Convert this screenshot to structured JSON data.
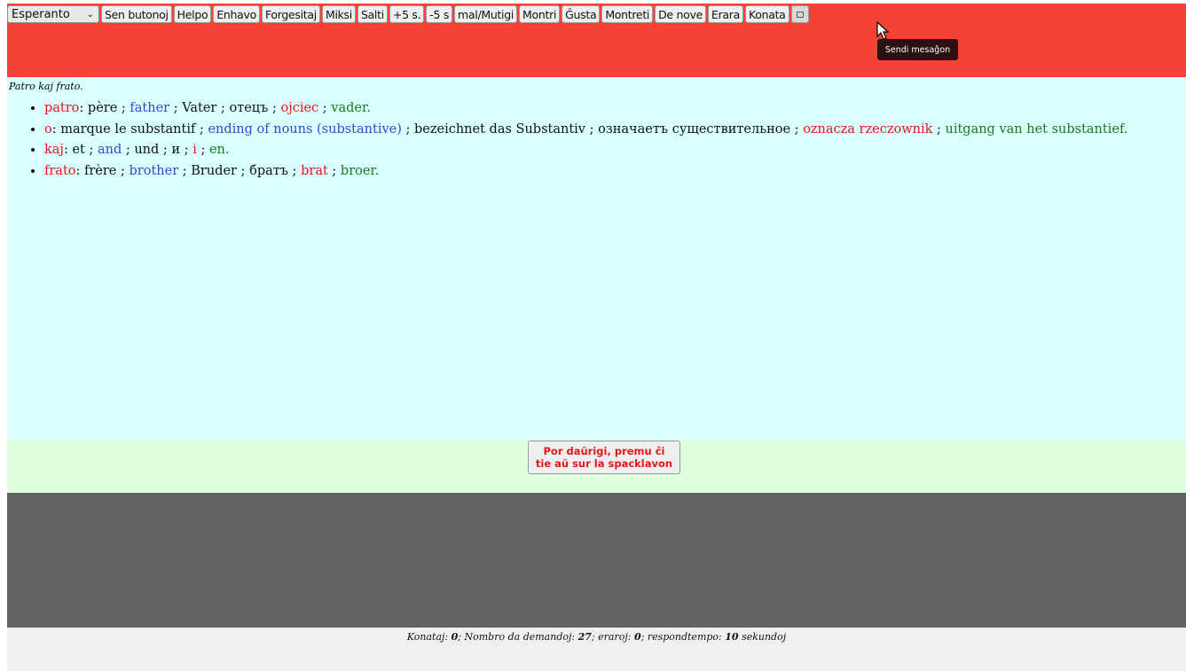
{
  "toolbar": {
    "language_select": "Esperanto",
    "buttons": [
      "Sen butonoj",
      "Helpo",
      "Enhavo",
      "Forgesitaj",
      "Miksi",
      "Salti",
      "+5 s.",
      "-5 s",
      "mal/Mutigi",
      "Montri",
      "Ĝusta",
      "Montreti",
      "De nove",
      "Erara",
      "Konata"
    ],
    "send_icon": "envelope-icon",
    "tooltip": "Sendi mesaĝon"
  },
  "sentence": "Patro kaj frato.",
  "glosses": [
    {
      "word": "patro",
      "fr": "père",
      "en": "father",
      "de": "Vater",
      "ru": "отецъ",
      "pl": "ojciec",
      "nl": "vader"
    },
    {
      "word": "o",
      "fr": "marque le substantif",
      "en": "ending of nouns (substantive)",
      "de": "bezeichnet das Substantiv",
      "ru": "означаетъ существительное",
      "pl": "oznacza rzeczownik",
      "nl": "uitgang van het substantief"
    },
    {
      "word": "kaj",
      "fr": "et",
      "en": "and",
      "de": "und",
      "ru": "и",
      "pl": "i",
      "nl": "en"
    },
    {
      "word": "frato",
      "fr": "frère",
      "en": "brother",
      "de": "Bruder",
      "ru": "братъ",
      "pl": "brat",
      "nl": "broer"
    }
  ],
  "answer_button": "Por daŭrigi, premu ĉi tie aŭ sur la spacklavon",
  "stats": {
    "known_label": "Konataj:",
    "known": "0",
    "questions_label": "Nombro da demandoj:",
    "questions": "27",
    "errors_label": "eraroj:",
    "errors": "0",
    "time_label": "respondtempo:",
    "time": "10",
    "time_unit": "sekundoj"
  },
  "colors": {
    "header": "#f44336",
    "content_bg": "#d9fffe",
    "answer_bg": "#ddffdd",
    "dark_bg": "#636363"
  }
}
